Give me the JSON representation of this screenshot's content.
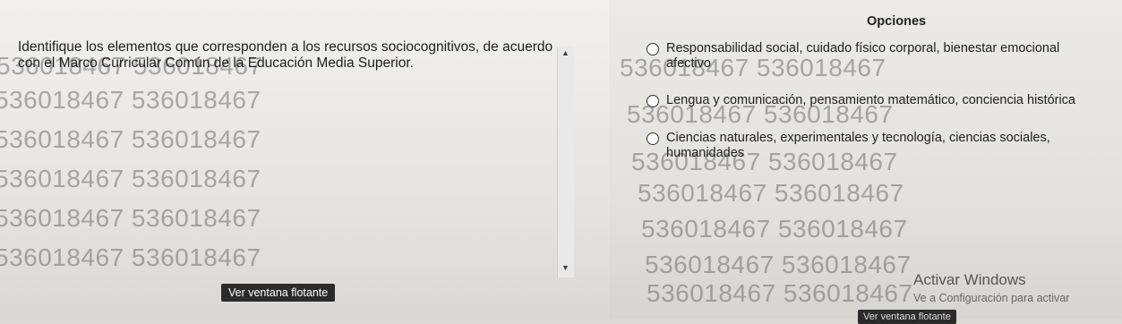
{
  "question": {
    "text": "Identifique los elementos que corresponden a los recursos sociocognitivos, de acuerdo con el Marco Curricular Común de la Educación Media Superior."
  },
  "options": {
    "title": "Opciones",
    "items": [
      {
        "label": "Responsabilidad social, cuidado físico corporal, bienestar emocional afectivo"
      },
      {
        "label": "Lengua y comunicación, pensamiento matemático, conciencia histórica"
      },
      {
        "label": "Ciencias naturales, experimentales y tecnología, ciencias sociales, humanidades"
      }
    ]
  },
  "floating_window": {
    "label": "Ver ventana flotante",
    "label_secondary": "Ver ventana flotante"
  },
  "watermark": {
    "text": "536018467 536018467"
  },
  "windows_activation": {
    "title": "Activar Windows",
    "subtitle": "Ve a Configuración para activar"
  },
  "icons": {
    "scroll_up": "▲",
    "scroll_down": "▼"
  }
}
